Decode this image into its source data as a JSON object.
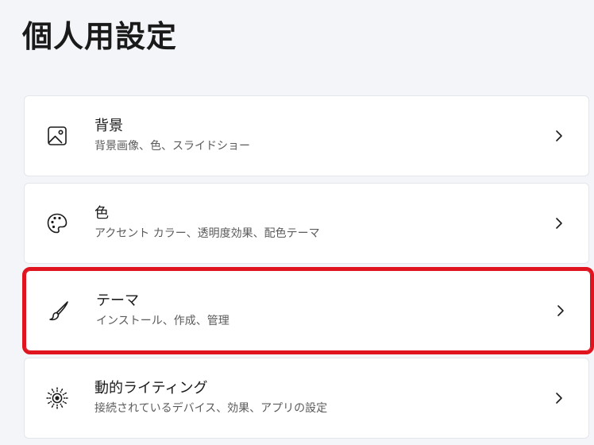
{
  "page": {
    "title": "個人用設定"
  },
  "items": [
    {
      "icon": "image-icon",
      "title": "背景",
      "subtitle": "背景画像、色、スライドショー"
    },
    {
      "icon": "palette-icon",
      "title": "色",
      "subtitle": "アクセント カラー、透明度効果、配色テーマ"
    },
    {
      "icon": "brush-icon",
      "title": "テーマ",
      "subtitle": "インストール、作成、管理",
      "highlighted": true
    },
    {
      "icon": "dynamic-lighting-icon",
      "title": "動的ライティング",
      "subtitle": "接続されているデバイス、効果、アプリの設定"
    }
  ],
  "colors": {
    "background": "#f3f5f9",
    "card": "#ffffff",
    "highlight": "#e0141e"
  }
}
